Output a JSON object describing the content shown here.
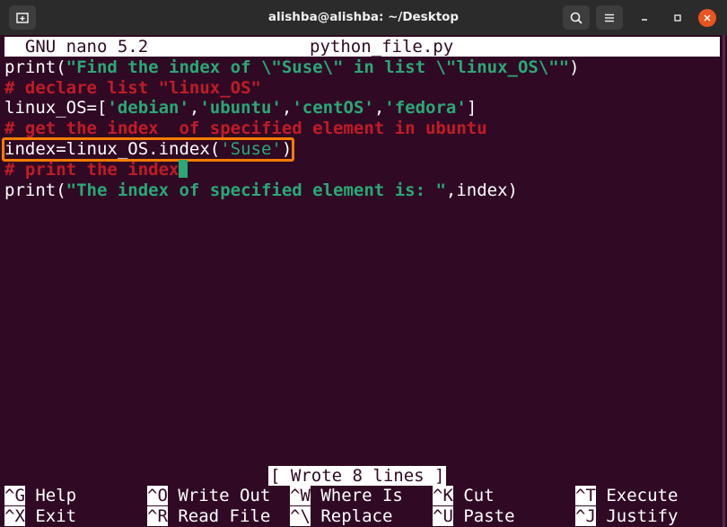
{
  "window": {
    "title": "alishba@alishba: ~/Desktop"
  },
  "nano": {
    "version": "GNU nano 5.2",
    "filename": "python_file.py",
    "status": "[ Wrote 8 lines ]"
  },
  "code": {
    "line1": {
      "fn": "print(",
      "str": "\"Find the index of \\\"Suse\\\" in list \\\"linux_OS\\\"\"",
      "end": ")"
    },
    "line2": "# declare list \"linux_OS\"",
    "line3": {
      "pre": "linux_OS=[",
      "s1": "'debian'",
      "c1": ",",
      "s2": "'ubuntu'",
      "c2": ",",
      "s3": "'centOS'",
      "c3": ",",
      "s4": "'fedora'",
      "end": "]"
    },
    "line4": "# get the index  of specified element in ubuntu",
    "line5": {
      "pre": "index=linux_OS.index(",
      "str": "'Suse'",
      "end": ")"
    },
    "line6": "# print the index",
    "line7": {
      "fn": "print(",
      "str": "\"The index of specified element is: \"",
      "end": ",index)"
    }
  },
  "shortcuts": [
    {
      "key": "^G",
      "label": "Help"
    },
    {
      "key": "^O",
      "label": "Write Out"
    },
    {
      "key": "^W",
      "label": "Where Is"
    },
    {
      "key": "^K",
      "label": "Cut"
    },
    {
      "key": "^T",
      "label": "Execute"
    },
    {
      "key": "^X",
      "label": "Exit"
    },
    {
      "key": "^R",
      "label": "Read File"
    },
    {
      "key": "^\\",
      "label": "Replace"
    },
    {
      "key": "^U",
      "label": "Paste"
    },
    {
      "key": "^J",
      "label": "Justify"
    }
  ],
  "colors": {
    "terminal_bg": "#300a24",
    "highlight_box": "#f57c00",
    "string": "#2aa876",
    "comment": "#c01c28"
  },
  "icons": [
    "new-tab-icon",
    "search-icon",
    "hamburger-menu-icon",
    "minimize-icon",
    "maximize-icon",
    "close-icon"
  ]
}
